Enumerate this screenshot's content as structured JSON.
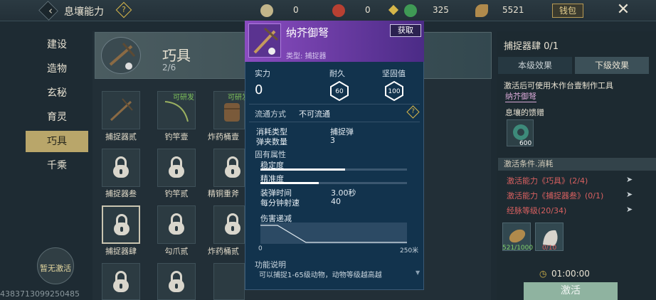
{
  "topbar": {
    "title": "息壤能力",
    "resources": [
      {
        "icon": "coin-icon",
        "color": "#c2b58a",
        "value": "0"
      },
      {
        "icon": "red-gem-icon",
        "color": "#b84032",
        "value": "0"
      },
      {
        "icon": "jade-icon",
        "color": "#3f9a55",
        "value": "325"
      },
      {
        "icon": "seed-icon",
        "color": "#b08a4c",
        "value": "5521"
      }
    ],
    "wallet_label": "钱包"
  },
  "sidebar": {
    "items": [
      {
        "label": "建设"
      },
      {
        "label": "造物"
      },
      {
        "label": "玄秘"
      },
      {
        "label": "育灵"
      },
      {
        "label": "巧具"
      },
      {
        "label": "千乘"
      }
    ],
    "active_index": 4,
    "not_activated": "暂无激活"
  },
  "uid": "4383713099250485",
  "category": {
    "name": "巧具",
    "count": "2/6"
  },
  "grid": {
    "rows": [
      [
        {
          "label": "捕捉器贰",
          "locked": false,
          "tag": ""
        },
        {
          "label": "钓竿壹",
          "locked": false,
          "tag": "可研发"
        },
        {
          "label": "炸药桶壹",
          "locked": false,
          "tag": "可研发"
        }
      ],
      [
        {
          "label": "捕捉器叁",
          "locked": true,
          "tag": ""
        },
        {
          "label": "钓竿贰",
          "locked": true,
          "tag": ""
        },
        {
          "label": "精铜重斧",
          "locked": true,
          "tag": ""
        }
      ],
      [
        {
          "label": "捕捉器肆",
          "locked": true,
          "tag": ""
        },
        {
          "label": "勾爪贰",
          "locked": true,
          "tag": ""
        },
        {
          "label": "炸药桶贰",
          "locked": true,
          "tag": ""
        }
      ]
    ]
  },
  "popup": {
    "name": "纳芥御弩",
    "type_text": "类型: 捕捉器",
    "obtain": "获取",
    "stats": {
      "strength_label": "实力",
      "strength": "0",
      "durability_label": "耐久",
      "durability": "60",
      "solidity_label": "坚固值",
      "solidity": "100"
    },
    "circulation_label": "流通方式",
    "circulation_value": "不可流通",
    "consume_type_label": "消耗类型",
    "consume_type_value": "捕捉弹",
    "clip_label": "弹夹数量",
    "clip_value": "3",
    "inherent_label": "固有属性",
    "stability_label": "稳定度",
    "stability_level": 0.58,
    "accuracy_label": "精准度",
    "accuracy_level": 0.4,
    "reload_label": "装弹时间",
    "reload_value": "3.00秒",
    "rpm_label": "每分钟射速",
    "rpm_value": "40",
    "falloff_label": "伤害递减",
    "falloff_x_start": "0",
    "falloff_x_end": "250米",
    "func_label": "功能说明",
    "func_text": "可以捕捉1-65级动物，动物等级越高越"
  },
  "right_panel": {
    "title": "捕捉器肆 0/1",
    "tab_current": "本级效果",
    "tab_next": "下级效果",
    "desc_line1": "激活后可使用木作台壹制作工具",
    "desc_line2": "纳芥御弩",
    "req_label": "息壤的馈赠",
    "req_item_count": "600",
    "cond_header": "激活条件.消耗",
    "conditions": [
      "激活能力《巧具》(2/4)",
      "激活能力《捕捉器叁》(0/1)",
      "经脉等级(20/34)"
    ],
    "cost_items": [
      {
        "count": "521/1000",
        "color": "#7fd06a"
      },
      {
        "count": "0/10",
        "color": "#e05a5a"
      }
    ],
    "timer": "01:00:00",
    "activate": "激活"
  },
  "colors": {
    "accent_gold": "#b9a66a",
    "popup_purple": "#8a4cc0",
    "condition_red": "#d86060",
    "activate_green": "#8fb3a0"
  }
}
